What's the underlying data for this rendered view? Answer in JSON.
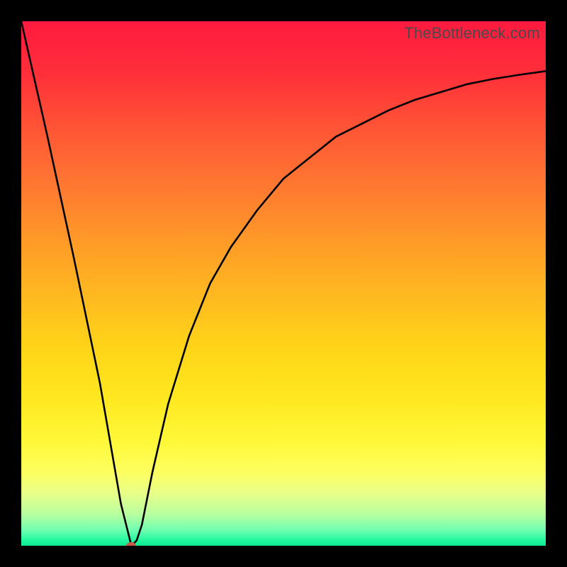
{
  "watermark": "TheBottleneck.com",
  "colors": {
    "frame": "#000000",
    "curve": "#000000",
    "marker": "#c85a4a"
  },
  "chart_data": {
    "type": "line",
    "title": "",
    "xlabel": "",
    "ylabel": "",
    "xlim": [
      0,
      100
    ],
    "ylim": [
      0,
      100
    ],
    "grid": false,
    "legend": false,
    "note": "Axis values are relative (no tick labels shown). y ≈ bottleneck % (0 = no bottleneck at bottom, 100 = max at top).",
    "series": [
      {
        "name": "bottleneck-curve",
        "x": [
          0,
          5,
          10,
          15,
          19,
          21,
          22,
          23,
          25,
          28,
          32,
          36,
          40,
          45,
          50,
          55,
          60,
          65,
          70,
          75,
          80,
          85,
          90,
          95,
          100
        ],
        "values": [
          100,
          78,
          55,
          31,
          8,
          0,
          1,
          4,
          14,
          27,
          40,
          50,
          57,
          64,
          70,
          74,
          78,
          80.5,
          83,
          85,
          86.5,
          88,
          89,
          89.8,
          90.5
        ]
      }
    ],
    "marker": {
      "x": 21,
      "y": 0
    }
  }
}
